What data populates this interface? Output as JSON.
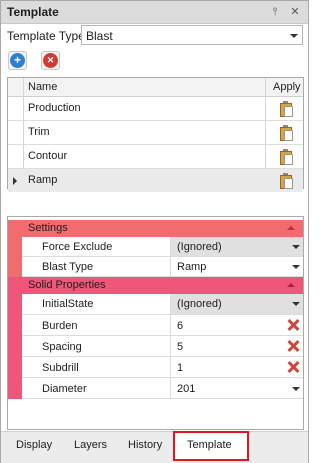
{
  "window": {
    "title": "Template",
    "pin_glyph": "⫯",
    "close_glyph": "✕"
  },
  "template_type": {
    "label": "Template Type",
    "value": "Blast"
  },
  "toolbar": {
    "add_glyph": "+",
    "remove_glyph": "✕"
  },
  "grid": {
    "columns": [
      "Name",
      "Apply"
    ],
    "rows": [
      {
        "name": "Production",
        "selected": false
      },
      {
        "name": "Trim",
        "selected": false
      },
      {
        "name": "Contour",
        "selected": false
      },
      {
        "name": "Ramp",
        "selected": true
      }
    ]
  },
  "properties": {
    "settings": {
      "label": "Settings",
      "rows": [
        {
          "key": "Force Exclude",
          "value": "(Ignored)"
        },
        {
          "key": "Blast Type",
          "value": "Ramp"
        }
      ]
    },
    "solid": {
      "label": "Solid Properties",
      "rows": [
        {
          "key": "InitialState",
          "value": "(Ignored)"
        },
        {
          "key": "Burden",
          "value": "6"
        },
        {
          "key": "Spacing",
          "value": "5"
        },
        {
          "key": "Subdrill",
          "value": "1"
        },
        {
          "key": "Diameter",
          "value": "201"
        }
      ]
    }
  },
  "tabs": [
    "Display",
    "Layers",
    "History",
    "Template"
  ],
  "active_tab": "Template",
  "colors": {
    "settings_category": "#f26b6f",
    "solid_category": "#f0557a",
    "active_tab_border": "#e0161c",
    "add_button": "#2f7fd1",
    "remove_button": "#d23a33"
  }
}
